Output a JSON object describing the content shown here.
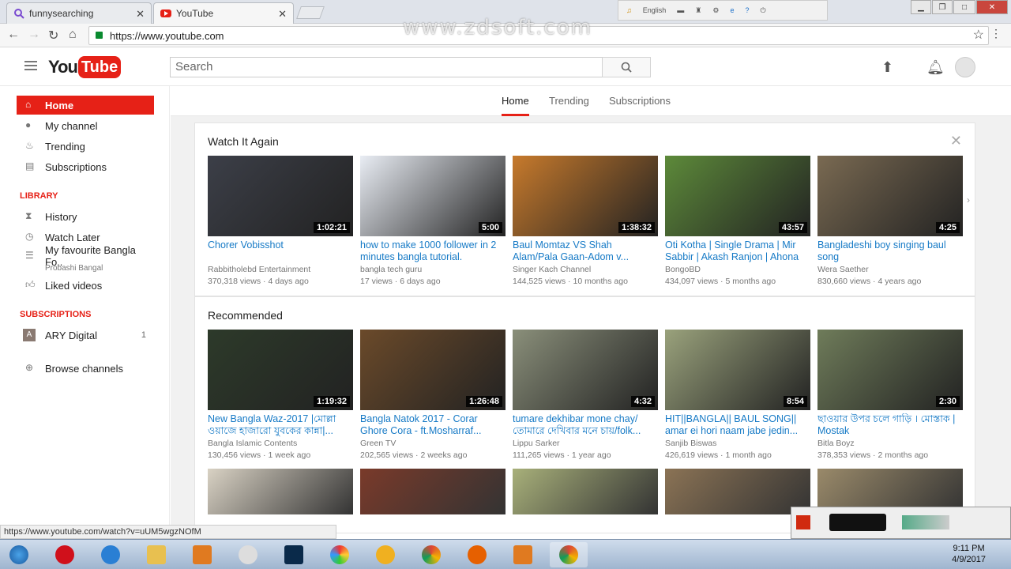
{
  "browser": {
    "tabs": [
      {
        "label": "funnysearching",
        "active": false
      },
      {
        "label": "YouTube",
        "active": true
      }
    ],
    "url": "https://www.youtube.com",
    "watermark": "www.zdsoft.com",
    "widget_lang": "English",
    "status_url": "https://www.youtube.com/watch?v=uUM5wgzNOfM"
  },
  "header": {
    "logo_you": "You",
    "logo_tube": "Tube",
    "search_placeholder": "Search"
  },
  "sidebar": {
    "items": [
      {
        "label": "Home",
        "icon": "home-icon"
      },
      {
        "label": "My channel",
        "icon": "person-icon"
      },
      {
        "label": "Trending",
        "icon": "flame-icon"
      },
      {
        "label": "Subscriptions",
        "icon": "subscriptions-icon"
      }
    ],
    "library_heading": "LIBRARY",
    "library": [
      {
        "label": "History",
        "icon": "hourglass-icon"
      },
      {
        "label": "Watch Later",
        "icon": "clock-icon"
      },
      {
        "label": "My favourite Bangla Fo..",
        "sub": "Probashi Bangal",
        "icon": "playlist-icon"
      },
      {
        "label": "Liked videos",
        "icon": "thumbs-up-icon"
      }
    ],
    "subscriptions_heading": "SUBSCRIPTIONS",
    "subscriptions": [
      {
        "label": "ARY Digital",
        "count": "1",
        "avatar": "A"
      }
    ],
    "browse": "Browse channels"
  },
  "tabs": [
    "Home",
    "Trending",
    "Subscriptions"
  ],
  "watch_again": {
    "title": "Watch It Again",
    "videos": [
      {
        "title": "Chorer Vobisshot",
        "channel": "Rabbitholebd Entertainment",
        "views": "370,318 views",
        "age": "4 days ago",
        "duration": "1:02:21",
        "color": "#3c3f48"
      },
      {
        "title": "how to make 1000 follower in 2 minutes bangla tutorial.",
        "channel": "bangla tech guru",
        "views": "17 views",
        "age": "6 days ago",
        "duration": "5:00",
        "color": "#e9edf4"
      },
      {
        "title": "Baul Momtaz VS Shah Alam/Pala Gaan-Adom v...",
        "channel": "Singer Kach Channel",
        "views": "144,525 views",
        "age": "10 months ago",
        "duration": "1:38:32",
        "color": "#c77a2c"
      },
      {
        "title": "Oti Kotha | Single Drama | Mir Sabbir | Akash Ranjon | Ahona",
        "channel": "BongoBD",
        "views": "434,097 views",
        "age": "5 months ago",
        "duration": "43:57",
        "color": "#5d8a3a"
      },
      {
        "title": "Bangladeshi boy singing baul song",
        "channel": "Wera Saether",
        "views": "830,660 views",
        "age": "4 years ago",
        "duration": "4:25",
        "color": "#7a6a52"
      }
    ]
  },
  "recommended": {
    "title": "Recommended",
    "videos": [
      {
        "title": "New Bangla Waz-2017 |মোল্লা ওয়াজে হাজারো যুবকের কান্না|...",
        "channel": "Bangla Islamic Contents",
        "views": "130,456 views",
        "age": "1 week ago",
        "duration": "1:19:32",
        "color": "#2d3a2a"
      },
      {
        "title": "Bangla Natok 2017 - Corar Ghore Cora - ft.Mosharraf...",
        "channel": "Green TV",
        "views": "202,565 views",
        "age": "2 weeks ago",
        "duration": "1:26:48",
        "color": "#6b4a2a"
      },
      {
        "title": "tumare dekhibar mone chay/ তোমারে দেখিবার মনে চায়/folk...",
        "channel": "Lippu Sarker",
        "views": "111,265 views",
        "age": "1 year ago",
        "duration": "4:32",
        "color": "#8a8f7a"
      },
      {
        "title": "HIT||BANGLA|| BAUL SONG|| amar ei hori naam jabe jedin...",
        "channel": "Sanjib Biswas",
        "views": "426,619 views",
        "age": "1 month ago",
        "duration": "8:54",
        "color": "#9aa27c"
      },
      {
        "title": "ছাওয়ার উপর চলে গাড়ি । মোস্তাক | Mostak",
        "channel": "Bitla Boyz",
        "views": "378,353 views",
        "age": "2 months ago",
        "duration": "2:30",
        "color": "#6f7c5a"
      }
    ],
    "row2_colors": [
      "#d9d2c4",
      "#7a3a2a",
      "#a8b07a",
      "#8b7355",
      "#9a8a6a"
    ]
  },
  "taskbar": {
    "time": "9:11 PM",
    "date": "4/9/2017"
  }
}
